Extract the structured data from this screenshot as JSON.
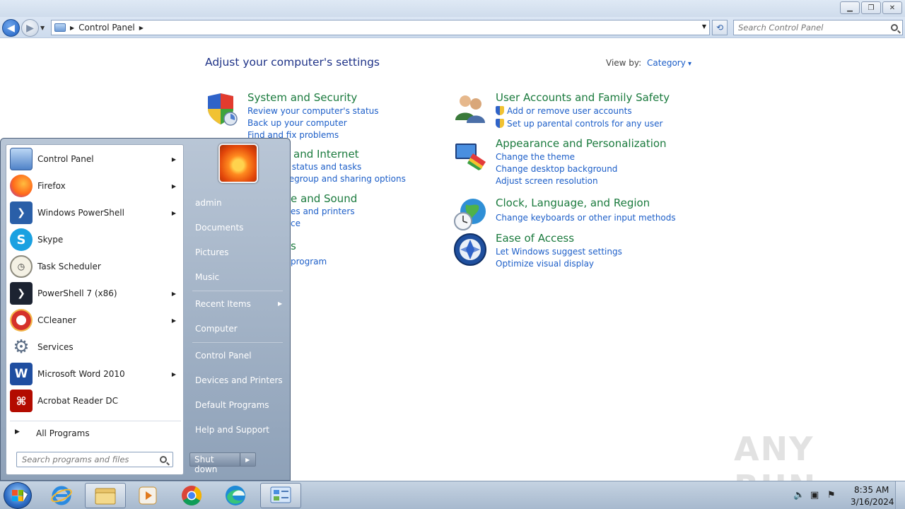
{
  "window": {
    "address_segments": [
      "Control Panel"
    ],
    "search_placeholder": "Search Control Panel",
    "buttons": [
      "minimize",
      "restore",
      "close"
    ]
  },
  "content": {
    "title": "Adjust your computer's settings",
    "view_by_label": "View by:",
    "view_by_value": "Category",
    "categories": [
      {
        "title": "System and Security",
        "icon": "shield-icon",
        "links": [
          "Review your computer's status",
          "Back up your computer",
          "Find and fix problems"
        ]
      },
      {
        "title": "Network and Internet",
        "icon": "network-icon",
        "links": [
          "View network status and tasks",
          "Choose homegroup and sharing options"
        ]
      },
      {
        "title": "Hardware and Sound",
        "icon": "printer-icon",
        "links": [
          "View devices and printers",
          "Add a device"
        ]
      },
      {
        "title": "Programs",
        "icon": "programs-icon",
        "links": [
          "Uninstall a program"
        ]
      },
      {
        "title": "User Accounts and Family Safety",
        "icon": "users-icon",
        "links": [
          "Add or remove user accounts",
          "Set up parental controls for any user"
        ]
      },
      {
        "title": "Appearance and Personalization",
        "icon": "monitor-icon",
        "links": [
          "Change the theme",
          "Change desktop background",
          "Adjust screen resolution"
        ]
      },
      {
        "title": "Clock, Language, and Region",
        "icon": "globe-clock-icon",
        "links": [
          "Change keyboards or other input methods"
        ]
      },
      {
        "title": "Ease of Access",
        "icon": "ease-of-access-icon",
        "links": [
          "Let Windows suggest settings",
          "Optimize visual display"
        ]
      }
    ],
    "visible_fragments": {
      "network_title": "and Internet",
      "network_link1": "rk status and tasks",
      "network_link2": "megroup and sharing options",
      "hardware_title": "e and Sound",
      "hardware_link1": "es and printers",
      "hardware_link2": "ce",
      "programs_title": "s",
      "programs_link1": "program"
    }
  },
  "start_menu": {
    "programs": [
      {
        "label": "Control Panel",
        "icon": "control-panel-icon",
        "submenu": true
      },
      {
        "label": "Firefox",
        "icon": "firefox-icon",
        "submenu": true
      },
      {
        "label": "Windows PowerShell",
        "icon": "powershell-icon",
        "submenu": true
      },
      {
        "label": "Skype",
        "icon": "skype-icon",
        "submenu": false
      },
      {
        "label": "Task Scheduler",
        "icon": "clock-icon",
        "submenu": false
      },
      {
        "label": "PowerShell 7 (x86)",
        "icon": "powershell7-icon",
        "submenu": true
      },
      {
        "label": "CCleaner",
        "icon": "ccleaner-icon",
        "submenu": true
      },
      {
        "label": "Services",
        "icon": "gears-icon",
        "submenu": false
      },
      {
        "label": "Microsoft Word 2010",
        "icon": "word-icon",
        "submenu": true
      },
      {
        "label": "Acrobat Reader DC",
        "icon": "acrobat-icon",
        "submenu": false
      }
    ],
    "all_programs": "All Programs",
    "search_placeholder": "Search programs and files",
    "right_links": [
      "admin",
      "Documents",
      "Pictures",
      "Music",
      "Recent Items",
      "Computer",
      "Control Panel",
      "Devices and Printers",
      "Default Programs",
      "Help and Support"
    ],
    "shutdown_label": "Shut down"
  },
  "taskbar": {
    "apps": [
      "internet-explorer-icon",
      "file-explorer-icon",
      "media-player-icon",
      "chrome-icon",
      "edge-icon",
      "control-panel-icon"
    ],
    "time": "8:35 AM",
    "date": "3/16/2024"
  },
  "watermark": "ANY RUN",
  "colors": {
    "link": "#1c5ec8",
    "category_title": "#1a7a3d",
    "page_title": "#1e3287"
  }
}
